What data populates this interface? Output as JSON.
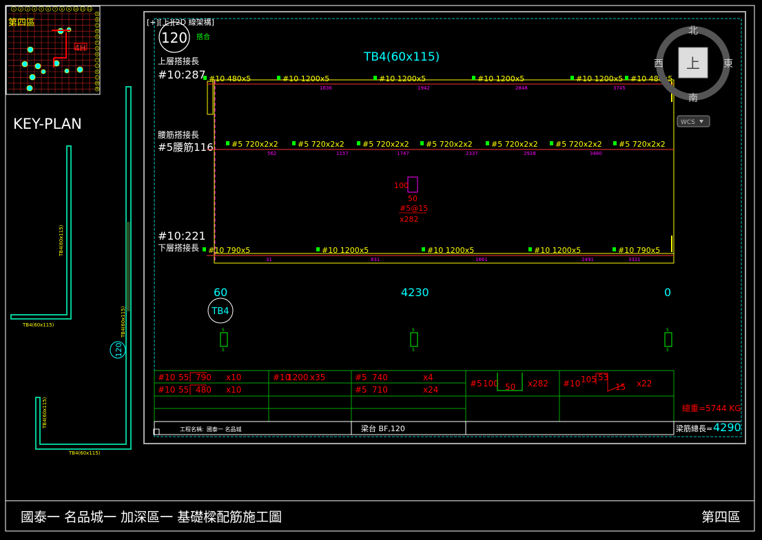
{
  "viewport_label": "[+][上][2D 線架構]",
  "beam": {
    "section_number": "120",
    "joint_label": "搭合",
    "title": "TB4(60x115)",
    "top_splice_label": "上層搭接長",
    "top_splice_value": "#10:287",
    "waist_splice_label": "腰筋搭接長",
    "waist_splice_value": "#5腰筋116",
    "bottom_splice_value": "#10:221",
    "bottom_splice_label": "下層搭接長",
    "top_bars": [
      "#10  480x5",
      "#10  1200x5",
      "#10  1200x5",
      "#10  1200x5",
      "#10  1200x5",
      "#10  480x5"
    ],
    "top_marks": [
      "1836",
      "1942",
      "2848",
      "3745"
    ],
    "waist_bars": [
      "#5  720x2x2",
      "#5  720x2x2",
      "#5  720x2x2",
      "#5  720x2x2",
      "#5  720x2x2",
      "#5  720x2x2",
      "#5  720x2x2"
    ],
    "waist_marks": [
      "562",
      "1157",
      "1747",
      "2337",
      "2928",
      "3480"
    ],
    "bottom_bars": [
      "#10  790x5",
      "#10  1200x5",
      "#10  1200x5",
      "#10  1200x5",
      "#10  790x5"
    ],
    "bottom_marks": [
      "31",
      "831",
      "1661",
      "2491",
      "3321"
    ],
    "stirrup": {
      "dim_a": "100",
      "dim_b": "50",
      "spec": "#5@15",
      "count": "x282"
    },
    "left_width": "60",
    "span_length": "4230",
    "right_width": "0",
    "bubble_label": "TB4",
    "pier_marks": [
      "5",
      "5",
      "5",
      "5",
      "5",
      "5"
    ]
  },
  "schedule": {
    "row1": [
      {
        "bar": "#10",
        "a": "55",
        "b": "790",
        "n": "x10"
      },
      {
        "bar": "#10",
        "a": "",
        "b": "1200",
        "n": "x35"
      },
      {
        "bar": "#5",
        "a": "",
        "b": "740",
        "n": "x4"
      },
      {
        "bar": "#5",
        "a": "100",
        "b": "50",
        "n": "x282"
      },
      {
        "bar": "#10",
        "a": "105",
        "b": "53",
        "c": "15",
        "n": "x22"
      }
    ],
    "row2": [
      {
        "bar": "#10",
        "a": "55",
        "b": "480",
        "n": "x10"
      },
      {
        "bar": "#5",
        "a": "",
        "b": "710",
        "n": "x24"
      }
    ],
    "weight": "總重=5744  KG",
    "project_label": "工程名稱:",
    "project_name": "國泰一 名品城",
    "location": "梁台  BF,120",
    "total_length_label": "梁筋總長=",
    "total_length": "4290"
  },
  "keyplan": {
    "title": "KEY-PLAN",
    "zone": "第四區",
    "marker": "4H",
    "beam_labels": [
      "TB4(60x115)",
      "TB4(60x115)",
      "TB4(60x115)",
      "TB4(60x115)",
      "TB4(60x115)"
    ],
    "section_bubble": "120",
    "grid_letters": [
      "A",
      "B",
      "C",
      "D",
      "E",
      "F",
      "G",
      "H",
      "I",
      "J",
      "K",
      "L",
      "M",
      "N"
    ],
    "grid_numbers": [
      "1",
      "2",
      "3",
      "4",
      "5",
      "6",
      "7",
      "8",
      "9",
      "10",
      "11",
      "12"
    ]
  },
  "viewcube": {
    "north": "北",
    "south": "南",
    "east": "東",
    "west": "西",
    "top": "上",
    "wcs": "WCS"
  },
  "footer": {
    "title": "國泰一 名品城一 加深區一 基礎樑配筋施工圖",
    "zone": "第四區"
  },
  "colors": {
    "background": "#000000",
    "frame": "#ffffff",
    "rebar": "#ffff00",
    "dim": "#ff0000",
    "cyan": "#00ffff",
    "grid": "#00cc00",
    "magenta": "#ff00ff"
  }
}
